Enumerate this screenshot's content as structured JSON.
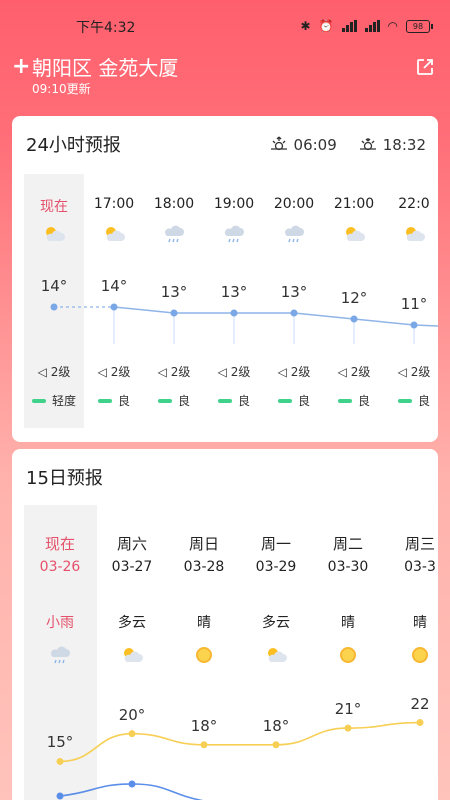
{
  "status_bar": {
    "time": "下午4:32",
    "battery": "98"
  },
  "header": {
    "location": "朝阳区 金苑大厦",
    "update_time": "09:10更新"
  },
  "hourly": {
    "title": "24小时预报",
    "sunrise": "06:09",
    "sunset": "18:32",
    "items": [
      {
        "time": "现在",
        "icon": "partly-cloudy-icon",
        "temp": "14°",
        "wind": "2级",
        "aqi": "轻度"
      },
      {
        "time": "17:00",
        "icon": "partly-cloudy-icon",
        "temp": "14°",
        "wind": "2级",
        "aqi": "良"
      },
      {
        "time": "18:00",
        "icon": "rain-cloud-icon",
        "temp": "13°",
        "wind": "2级",
        "aqi": "良"
      },
      {
        "time": "19:00",
        "icon": "rain-cloud-icon",
        "temp": "13°",
        "wind": "2级",
        "aqi": "良"
      },
      {
        "time": "20:00",
        "icon": "rain-cloud-icon",
        "temp": "13°",
        "wind": "2级",
        "aqi": "良"
      },
      {
        "time": "21:00",
        "icon": "partly-cloudy-icon",
        "temp": "12°",
        "wind": "2级",
        "aqi": "良"
      },
      {
        "time": "22:0",
        "icon": "partly-cloudy-icon",
        "temp": "11°",
        "wind": "2级",
        "aqi": "良"
      }
    ],
    "temps": [
      14,
      14,
      13,
      13,
      13,
      12,
      11
    ],
    "aqi_color": "#3fd28a"
  },
  "daily": {
    "title": "15日预报",
    "items": [
      {
        "day": "现在",
        "date": "03-26",
        "weather": "小雨",
        "icon": "rain-cloud-icon",
        "high": "15°"
      },
      {
        "day": "周六",
        "date": "03-27",
        "weather": "多云",
        "icon": "partly-cloudy-icon",
        "high": "20°"
      },
      {
        "day": "周日",
        "date": "03-28",
        "weather": "晴",
        "icon": "sun-icon",
        "high": "18°"
      },
      {
        "day": "周一",
        "date": "03-29",
        "weather": "多云",
        "icon": "partly-cloudy-icon",
        "high": "18°"
      },
      {
        "day": "周二",
        "date": "03-30",
        "weather": "晴",
        "icon": "sun-icon",
        "high": "21°"
      },
      {
        "day": "周三",
        "date": "03-3",
        "weather": "晴",
        "icon": "sun-icon",
        "high": "22"
      }
    ],
    "highs": [
      15,
      20,
      18,
      18,
      21,
      22
    ],
    "accent": "#e5506a",
    "high_line_color": "#f7cf55",
    "low_line_color": "#5b8ee8"
  }
}
